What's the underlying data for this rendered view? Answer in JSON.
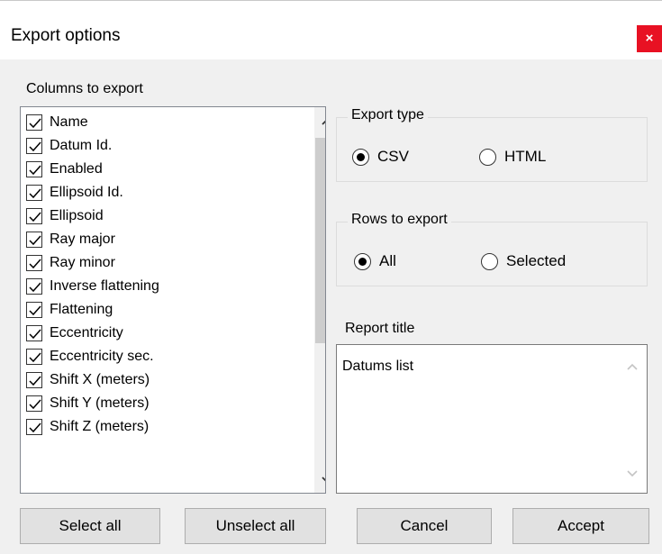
{
  "window": {
    "title": "Export options",
    "close_icon": "×"
  },
  "columns": {
    "label": "Columns to export",
    "items": [
      {
        "label": "Name",
        "checked": true
      },
      {
        "label": "Datum Id.",
        "checked": true
      },
      {
        "label": "Enabled",
        "checked": true
      },
      {
        "label": "Ellipsoid Id.",
        "checked": true
      },
      {
        "label": "Ellipsoid",
        "checked": true
      },
      {
        "label": "Ray major",
        "checked": true
      },
      {
        "label": "Ray minor",
        "checked": true
      },
      {
        "label": "Inverse flattening",
        "checked": true
      },
      {
        "label": "Flattening",
        "checked": true
      },
      {
        "label": "Eccentricity",
        "checked": true
      },
      {
        "label": "Eccentricity sec.",
        "checked": true
      },
      {
        "label": "Shift X (meters)",
        "checked": true
      },
      {
        "label": "Shift Y (meters)",
        "checked": true
      },
      {
        "label": "Shift Z (meters)",
        "checked": true
      }
    ]
  },
  "export_type": {
    "label": "Export type",
    "options": [
      {
        "label": "CSV",
        "selected": true
      },
      {
        "label": "HTML",
        "selected": false
      }
    ]
  },
  "rows_to_export": {
    "label": "Rows to export",
    "options": [
      {
        "label": "All",
        "selected": true
      },
      {
        "label": "Selected",
        "selected": false
      }
    ]
  },
  "report_title": {
    "label": "Report title",
    "value": "Datums list"
  },
  "buttons": {
    "select_all": "Select all",
    "unselect_all": "Unselect all",
    "cancel": "Cancel",
    "accept": "Accept"
  }
}
